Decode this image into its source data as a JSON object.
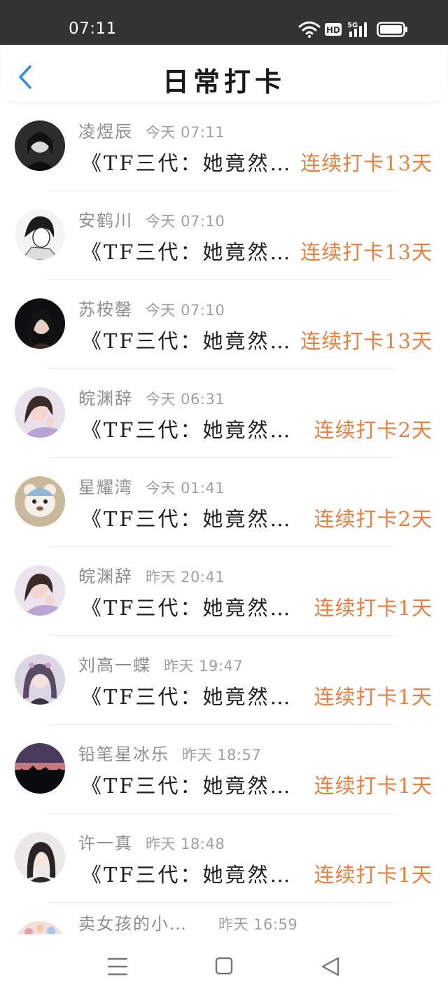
{
  "status_bar": {
    "time": "07:11",
    "icons": [
      "wifi-icon",
      "hd-icon",
      "signal-5g-icon",
      "battery-icon"
    ]
  },
  "header": {
    "title": "日常打卡",
    "back_icon": "chevron-left-icon"
  },
  "colors": {
    "accent": "#ee7e3b",
    "back_arrow": "#2f8fe6",
    "status_bar_bg": "#333333"
  },
  "checkins": [
    {
      "name": "凌煜辰",
      "time": "今天 07:11",
      "post": "《TF三代：她竟然…",
      "streak": "连续打卡13天"
    },
    {
      "name": "安鹤川",
      "time": "今天 07:10",
      "post": "《TF三代：她竟然…",
      "streak": "连续打卡13天"
    },
    {
      "name": "苏桉罄",
      "time": "今天 07:10",
      "post": "《TF三代：她竟然…",
      "streak": "连续打卡13天"
    },
    {
      "name": "皖渊辞",
      "time": "今天 06:31",
      "post": "《TF三代：她竟然…",
      "streak": "连续打卡2天"
    },
    {
      "name": "星耀湾",
      "time": "今天 01:41",
      "post": "《TF三代：她竟然…",
      "streak": "连续打卡2天"
    },
    {
      "name": "皖渊辞",
      "time": "昨天 20:41",
      "post": "《TF三代：她竟然…",
      "streak": "连续打卡1天"
    },
    {
      "name": "刘高一蝶",
      "time": "昨天 19:47",
      "post": "《TF三代：她竟然…",
      "streak": "连续打卡1天"
    },
    {
      "name": "铅笔星冰乐",
      "time": "昨天 18:57",
      "post": "《TF三代：她竟然…",
      "streak": "连续打卡1天"
    },
    {
      "name": "许一真",
      "time": "昨天 18:48",
      "post": "《TF三代：她竟然…",
      "streak": "连续打卡1天"
    },
    {
      "name": "卖女孩的小…",
      "time": "昨天 16:59",
      "post": "",
      "streak": ""
    }
  ],
  "system_nav": {
    "icons": [
      "menu-icon",
      "home-icon",
      "back-triangle-icon"
    ]
  }
}
